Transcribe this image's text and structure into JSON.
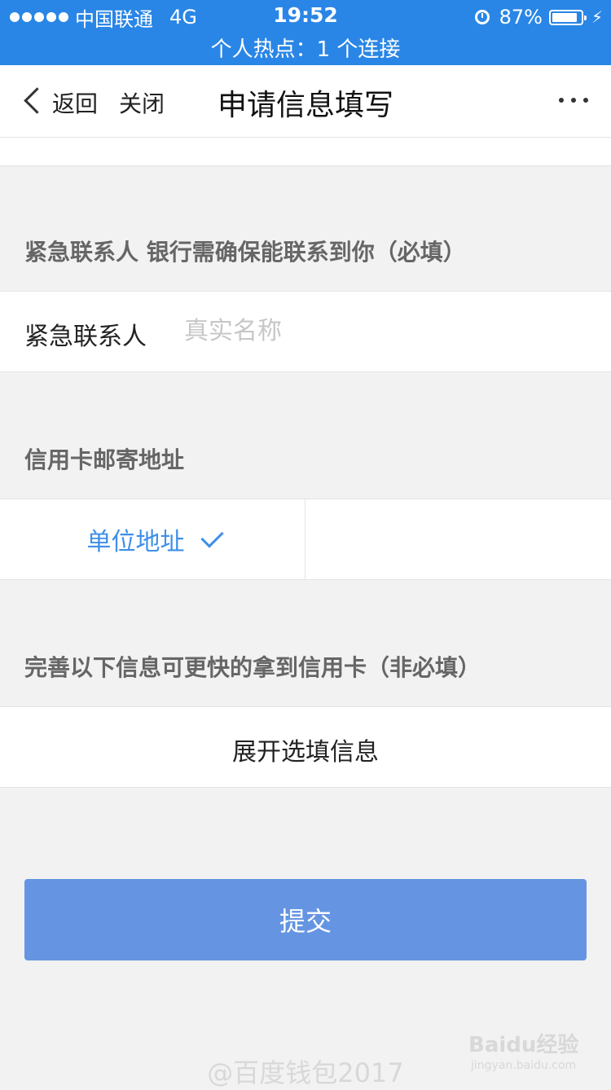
{
  "status_bar": {
    "carrier": "中国联通",
    "network": "4G",
    "time": "19:52",
    "battery": "87%",
    "battery_level": 0.87,
    "hotspot": "个人热点：1 个连接"
  },
  "nav": {
    "back_label": "返回",
    "close_label": "关闭",
    "title": "申请信息填写"
  },
  "emergency": {
    "section_label": "紧急联系人 银行需确保能联系到你（必填）",
    "field_label": "紧急联系人",
    "placeholder": "真实名称",
    "value": ""
  },
  "mailing": {
    "section_label": "信用卡邮寄地址",
    "option_label": "单位地址"
  },
  "optional": {
    "section_label": "完善以下信息可更快的拿到信用卡（非必填）",
    "expand_label": "展开选填信息"
  },
  "submit_label": "提交",
  "watermark": {
    "text": "@百度钱包2017",
    "brand": "Baidu经验",
    "url": "jingyan.baidu.com"
  },
  "colors": {
    "status_bar": "#2986e6",
    "accent": "#3d8fe8",
    "submit": "#6595e2"
  }
}
